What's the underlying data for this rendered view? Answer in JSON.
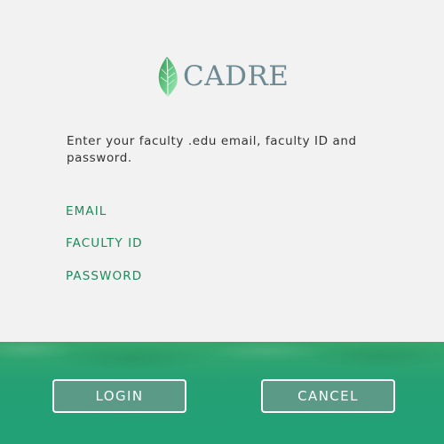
{
  "brand": {
    "name": "CADRE",
    "icon": "leaf-icon",
    "text_color": "#6e8a92",
    "leaf_color": "#3aa95f"
  },
  "instructions": "Enter your faculty .edu email, faculty ID and password.",
  "fields": {
    "email_label": "EMAIL",
    "faculty_id_label": "FACULTY ID",
    "password_label": "PASSWORD"
  },
  "actions": {
    "login_label": "LOGIN",
    "cancel_label": "CANCEL"
  },
  "colors": {
    "background": "#f2f2f2",
    "accent_green": "#1e8a5e",
    "footer_green": "#22a176",
    "button_fill": "#5b9a86"
  }
}
